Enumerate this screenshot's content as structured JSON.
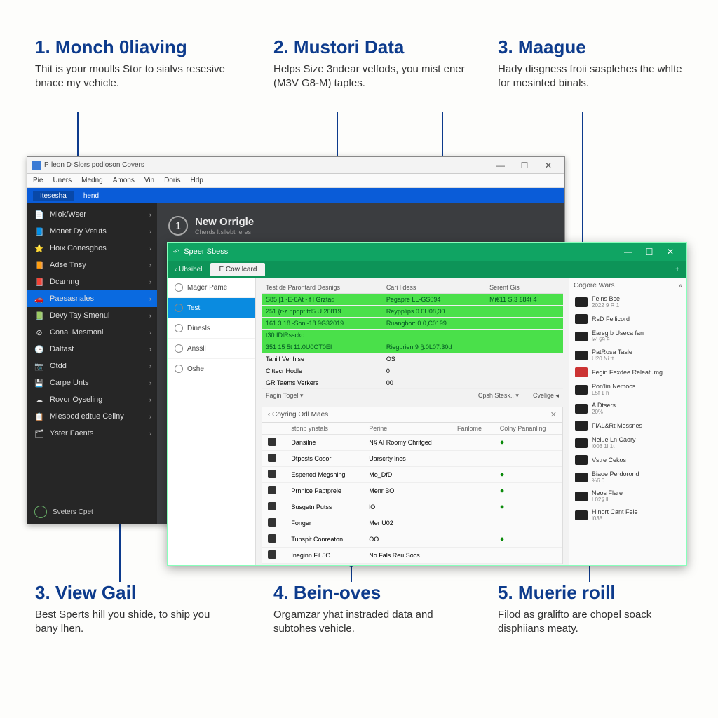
{
  "callouts": {
    "c1": {
      "title": "1. Monch 0liaving",
      "body": "Thit is your moulls Stor to sialvs resesive bnace my vehicle."
    },
    "c2": {
      "title": "2. Mustori Data",
      "body": "Helps Size 3ndear velfods, you mist ener (M3V G8-M) taples."
    },
    "c3": {
      "title": "3. Maague",
      "body": "Hady disgness froii sasplehes the whlte for mesinted binals."
    },
    "c4": {
      "title": "3. View Gail",
      "body": "Best Sperts hill you shide, to ship you bany lhen."
    },
    "c5": {
      "title": "4. Bein-oves",
      "body": "Orgamzar yhat instraded data and subtohes vehicle."
    },
    "c6": {
      "title": "5. Muerie roill",
      "body": "Filod as gralifto are chopel soack disphiians meaty."
    }
  },
  "dark_window": {
    "title": "P·leon D·Slors podloson Covers",
    "menu": [
      "Pie",
      "Uners",
      "Medng",
      "Amons",
      "Vin",
      "Doris",
      "Hdp"
    ],
    "ribbon": {
      "tab1": "Itesesha",
      "tab2": "hend"
    },
    "sidebar": [
      {
        "icon": "📄",
        "label": "Mlok/Wser"
      },
      {
        "icon": "📘",
        "label": "Monet Dy Vetuts"
      },
      {
        "icon": "⭐",
        "label": "Hoix Conesghos"
      },
      {
        "icon": "📙",
        "label": "Adse Tnsy"
      },
      {
        "icon": "📕",
        "label": "Dcarhng"
      },
      {
        "icon": "🚗",
        "label": "Paesasnales",
        "active": true
      },
      {
        "icon": "📗",
        "label": "Devy Tay Smenul"
      },
      {
        "icon": "⊘",
        "label": "Conal Mesmonl"
      },
      {
        "icon": "🕒",
        "label": "Dalfast"
      },
      {
        "icon": "📷",
        "label": "Otdd"
      },
      {
        "icon": "💾",
        "label": "Carpe Unts"
      },
      {
        "icon": "☁",
        "label": "Rovor Oyseling"
      },
      {
        "icon": "📋",
        "label": "Miespod edtue Celiny"
      },
      {
        "icon": "🗂",
        "label": "Yster Faents"
      }
    ],
    "bottom_user": "Sveters Cpet",
    "new_badge": {
      "num": "1",
      "title": "New Orrigle",
      "sub": "Cherds I.sllebtheres"
    }
  },
  "green_window": {
    "title": "Speer Sbess",
    "tabs": {
      "back": "‹ Ubsibel",
      "active": "E Cow lcard"
    },
    "left_nav": [
      {
        "label": "Mager Pame"
      },
      {
        "label": "Test",
        "selected": true
      },
      {
        "label": "Dinesls"
      },
      {
        "label": "Anssll"
      },
      {
        "label": "Oshe"
      }
    ],
    "info_headers": [
      "Test de Parontard Desnigs",
      "Cari l dess",
      "Serent Gis"
    ],
    "info_rows": [
      {
        "hl": true,
        "c1": "S85  |1 -E·6At - f l Grztad",
        "c2": "Pegapre LL-GS094",
        "c3": "Mi€11 S.3 £84t 4"
      },
      {
        "hl": true,
        "c1": "251  {r-z npqpt td5 U.20819",
        "c2": "Reypplips 0.0U08,30",
        "c3": ""
      },
      {
        "hl": true,
        "c1": "161  3 18 -Sonl-18 9G32019",
        "c2": "Ruangbor: 0 0,C0199",
        "c3": ""
      },
      {
        "hl": true,
        "c1": "t30  IDlRssckd",
        "c2": "",
        "c3": ""
      },
      {
        "hl": true,
        "c1": "351  15  5t 11.0U0OT0EI",
        "c2": "Riegprien 9 §.0L07.30d",
        "c3": ""
      },
      {
        "hl": false,
        "c1": "Tanill Venhlse",
        "c2": "OS",
        "c3": ""
      },
      {
        "hl": false,
        "c1": "Cittecr Hodle",
        "c2": "0",
        "c3": ""
      },
      {
        "hl": false,
        "c1": "GR Taems Verkers",
        "c2": "00",
        "c3": ""
      }
    ],
    "subheader": {
      "a": "Fagin Togel ▾",
      "b": "Cpsh Stesk.. ▾",
      "c": "Cvelige ◂"
    },
    "section2": {
      "title": "‹  Coyring Odl Maes",
      "headers": [
        "",
        "stonp ynstals",
        "Perine",
        "Fanlome",
        "Colny Pananling"
      ],
      "rows": [
        {
          "a": "Dansilne",
          "b": "N§ AI Roomy Chritged",
          "ok": true
        },
        {
          "a": "Dtpests Cosor",
          "b": "Uarscrty lnes",
          "ok": false
        },
        {
          "a": "Espenod Megshing",
          "b": "Mo_DfD",
          "ok": true
        },
        {
          "a": "Prnnice Paptprele",
          "b": "Menr BO",
          "ok": true
        },
        {
          "a": "Susgetn Putss",
          "b": "lO",
          "ok": true
        },
        {
          "a": "Fonger",
          "b": "Mer U02",
          "ok": false
        },
        {
          "a": "Tupspit Conreaton",
          "b": "OO",
          "ok": true
        },
        {
          "a": "Ineginn Fil 5O",
          "b": "No Fals Reu Socs",
          "ok": false
        }
      ]
    },
    "right_pane": {
      "title": "Cogore Wars",
      "items": [
        {
          "label": "Feins Bce",
          "sub": "2022 9 R 1"
        },
        {
          "label": "RsD Feilicord",
          "sub": ""
        },
        {
          "label": "Earsg b Useca fan",
          "sub": "le' §9 9"
        },
        {
          "label": "PatRosa Tasle",
          "sub": "U20 Ni tt"
        },
        {
          "label": "Fegin Fexdee Releatumg",
          "sub": "",
          "red": true
        },
        {
          "label": "Pon'lin Nemocs",
          "sub": "L5f 1 h"
        },
        {
          "label": "A Dtsers",
          "sub": "20%"
        },
        {
          "label": "FiAL&Rt Messnes",
          "sub": ""
        },
        {
          "label": "Nelue Ln Caory",
          "sub": "l003 1l 1t"
        },
        {
          "label": "Vstre Cekos",
          "sub": ""
        },
        {
          "label": "Biaoe Perdorond",
          "sub": "%6 0"
        },
        {
          "label": "Neos Flare",
          "sub": "L02§ ll"
        },
        {
          "label": "Hinort Cant Fele",
          "sub": "l038"
        }
      ]
    }
  }
}
